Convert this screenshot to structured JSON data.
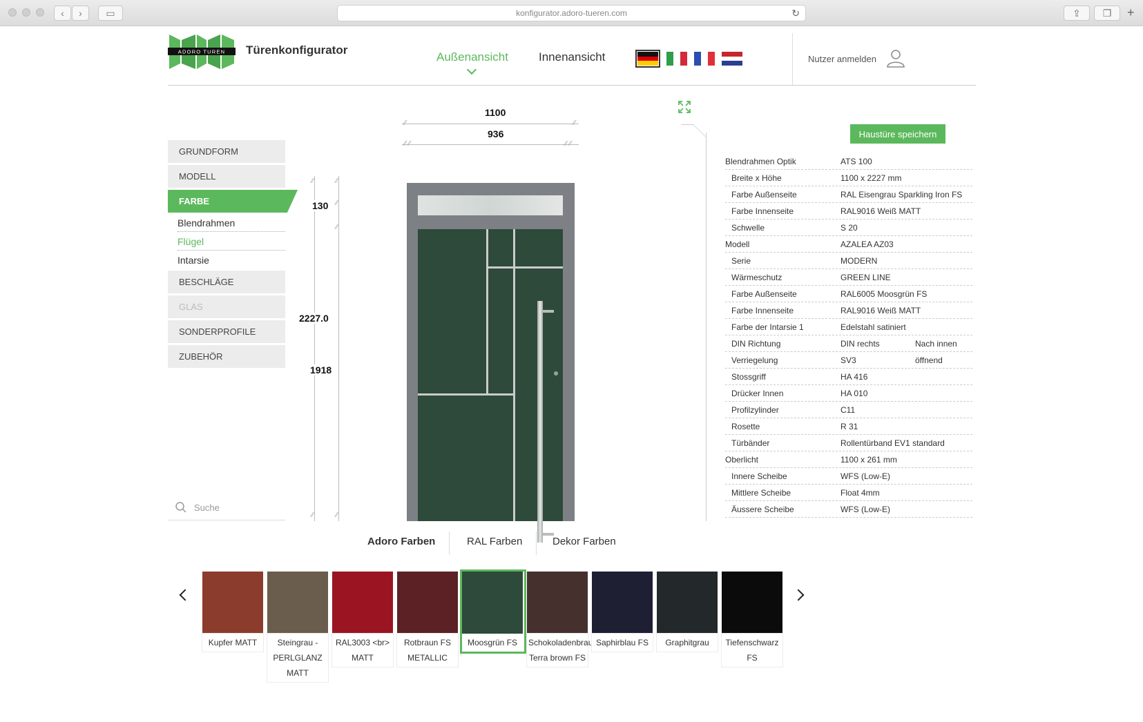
{
  "browser": {
    "url": "konfigurator.adoro-tueren.com"
  },
  "header": {
    "logo_text": "ADORO TUREN",
    "app_title": "Türenkonfigurator",
    "nav": [
      {
        "label": "Außenansicht",
        "active": true
      },
      {
        "label": "Innenansicht",
        "active": false
      }
    ],
    "flags": [
      "de",
      "it",
      "fr",
      "nl"
    ],
    "login_label": "Nutzer anmelden"
  },
  "sidebar": {
    "items": [
      {
        "label": "GRUNDFORM"
      },
      {
        "label": "MODELL"
      },
      {
        "label": "FARBE",
        "active": true
      },
      {
        "label": "BESCHLÄGE"
      },
      {
        "label": "GLAS",
        "disabled": true
      },
      {
        "label": "SONDERPROFILE"
      },
      {
        "label": "ZUBEHÖR"
      }
    ],
    "subitems": [
      {
        "label": "Blendrahmen"
      },
      {
        "label": "Flügel",
        "active": true
      },
      {
        "label": "Intarsie"
      }
    ],
    "search_placeholder": "Suche"
  },
  "dimensions": {
    "outer_width": "1100",
    "inner_width": "936",
    "transom_height": "130",
    "total_height": "2227.0",
    "leaf_height": "1918"
  },
  "panel": {
    "save_label": "Haustüre speichern",
    "specs": [
      {
        "key": "Blendrahmen Optik",
        "value": "ATS 100",
        "sub": false
      },
      {
        "key": "Breite x Höhe",
        "value": "1100 x 2227 mm",
        "sub": true
      },
      {
        "key": "Farbe Außenseite",
        "value": "RAL Eisengrau Sparkling Iron FS",
        "sub": true
      },
      {
        "key": "Farbe Innenseite",
        "value": "RAL9016 Weiß MATT",
        "sub": true
      },
      {
        "key": "Schwelle",
        "value": "S 20",
        "sub": true
      },
      {
        "key": "Modell",
        "value": "AZALEA AZ03",
        "sub": false
      },
      {
        "key": "Serie",
        "value": "MODERN",
        "sub": true
      },
      {
        "key": "Wärmeschutz",
        "value": "GREEN LINE",
        "sub": true
      },
      {
        "key": "Farbe Außenseite",
        "value": "RAL6005 Moosgrün FS",
        "sub": true
      },
      {
        "key": "Farbe Innenseite",
        "value": "RAL9016 Weiß MATT",
        "sub": true
      },
      {
        "key": "Farbe der Intarsie 1",
        "value": "Edelstahl satiniert",
        "sub": true
      },
      {
        "key": "DIN Richtung",
        "value": "DIN rechts",
        "value2": "Nach innen öffnend",
        "sub": true
      },
      {
        "key": "Verriegelung",
        "value": "SV3",
        "sub": true
      },
      {
        "key": "Stossgriff",
        "value": "HA 416",
        "sub": true
      },
      {
        "key": "Drücker Innen",
        "value": "HA 010",
        "sub": true
      },
      {
        "key": "Profilzylinder",
        "value": "C11",
        "sub": true
      },
      {
        "key": "Rosette",
        "value": "R 31",
        "sub": true
      },
      {
        "key": "Türbänder",
        "value": "Rollentürband EV1 standard",
        "sub": true
      },
      {
        "key": "Oberlicht",
        "value": "1100 x 261 mm",
        "sub": false
      },
      {
        "key": "Innere Scheibe",
        "value": "WFS (Low-E)",
        "sub": true
      },
      {
        "key": "Mittlere Scheibe",
        "value": "Float 4mm",
        "sub": true
      },
      {
        "key": "Äussere Scheibe",
        "value": "WFS (Low-E)",
        "sub": true
      }
    ]
  },
  "color_tabs": [
    {
      "label": "Adoro Farben",
      "active": true
    },
    {
      "label": "RAL Farben",
      "active": false
    },
    {
      "label": "Dekor Farben",
      "active": false
    }
  ],
  "swatches": [
    {
      "label": "Kupfer MATT",
      "color": "#8b3c2d"
    },
    {
      "label": "Steingrau - PERLGLANZ MATT",
      "color": "#6a5d4d"
    },
    {
      "label": "RAL3003 <br> MATT",
      "color": "#9a1422"
    },
    {
      "label": "Rotbraun FS METALLIC",
      "color": "#5b2124"
    },
    {
      "label": "Moosgrün FS",
      "color": "#2e4a3a",
      "selected": true
    },
    {
      "label": "Schokoladenbraun Terra brown FS",
      "color": "#45302d"
    },
    {
      "label": "Saphirblau FS",
      "color": "#1e1f33"
    },
    {
      "label": "Graphitgrau",
      "color": "#23282a"
    },
    {
      "label": "Tiefenschwarz FS",
      "color": "#0b0b0b"
    }
  ],
  "colors": {
    "accent": "#5cb85c"
  }
}
